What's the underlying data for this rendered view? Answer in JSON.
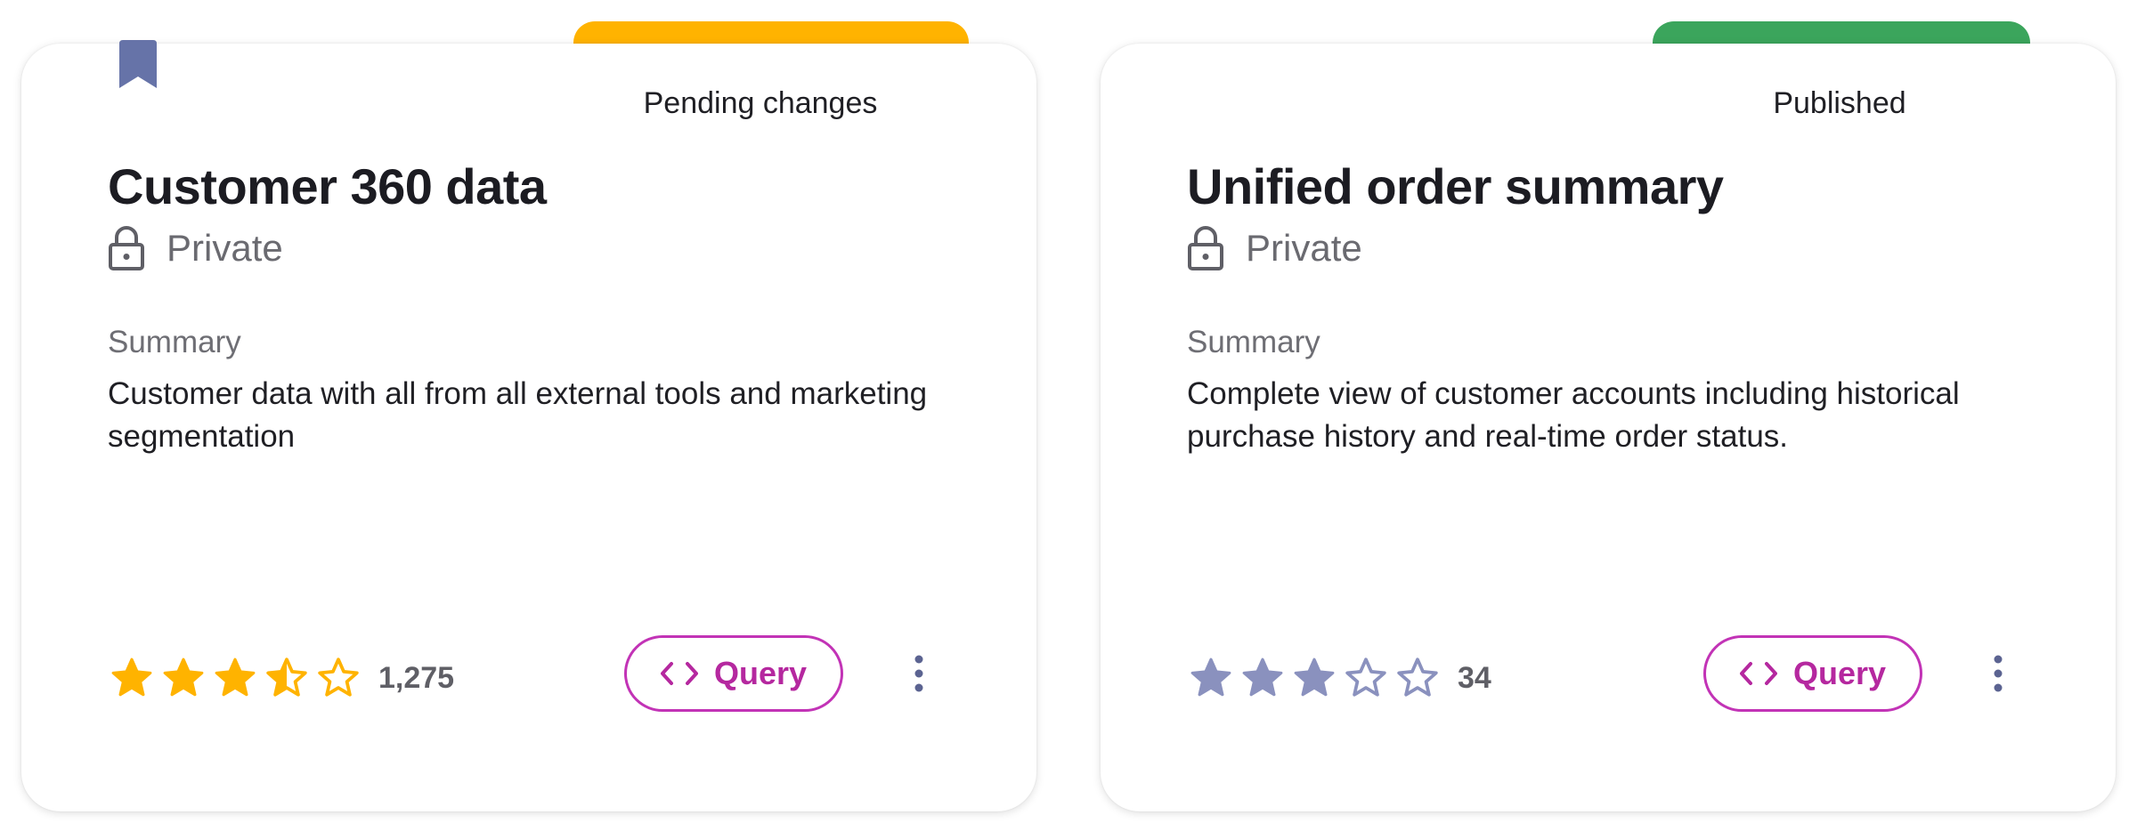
{
  "cards": [
    {
      "status": "Pending changes",
      "status_color": "#FFB300",
      "bookmarked": true,
      "title": "Customer 360 data",
      "visibility": "Private",
      "summary_label": "Summary",
      "summary": "Customer data with all from all external tools and marketing segmentation",
      "rating": 3.5,
      "rating_count": "1,275",
      "rating_color": "#FFB300",
      "query_label": "Query",
      "more_icon": "more-vertical-icon"
    },
    {
      "status": "Published",
      "status_color": "#3BA55C",
      "bookmarked": false,
      "title": "Unified order summary",
      "visibility": "Private",
      "summary_label": "Summary",
      "summary": "Complete view of customer accounts including historical purchase history and real-time order status.",
      "rating": 3,
      "rating_count": "34",
      "rating_color": "#8A91BE",
      "query_label": "Query",
      "more_icon": "more-vertical-icon"
    }
  ]
}
